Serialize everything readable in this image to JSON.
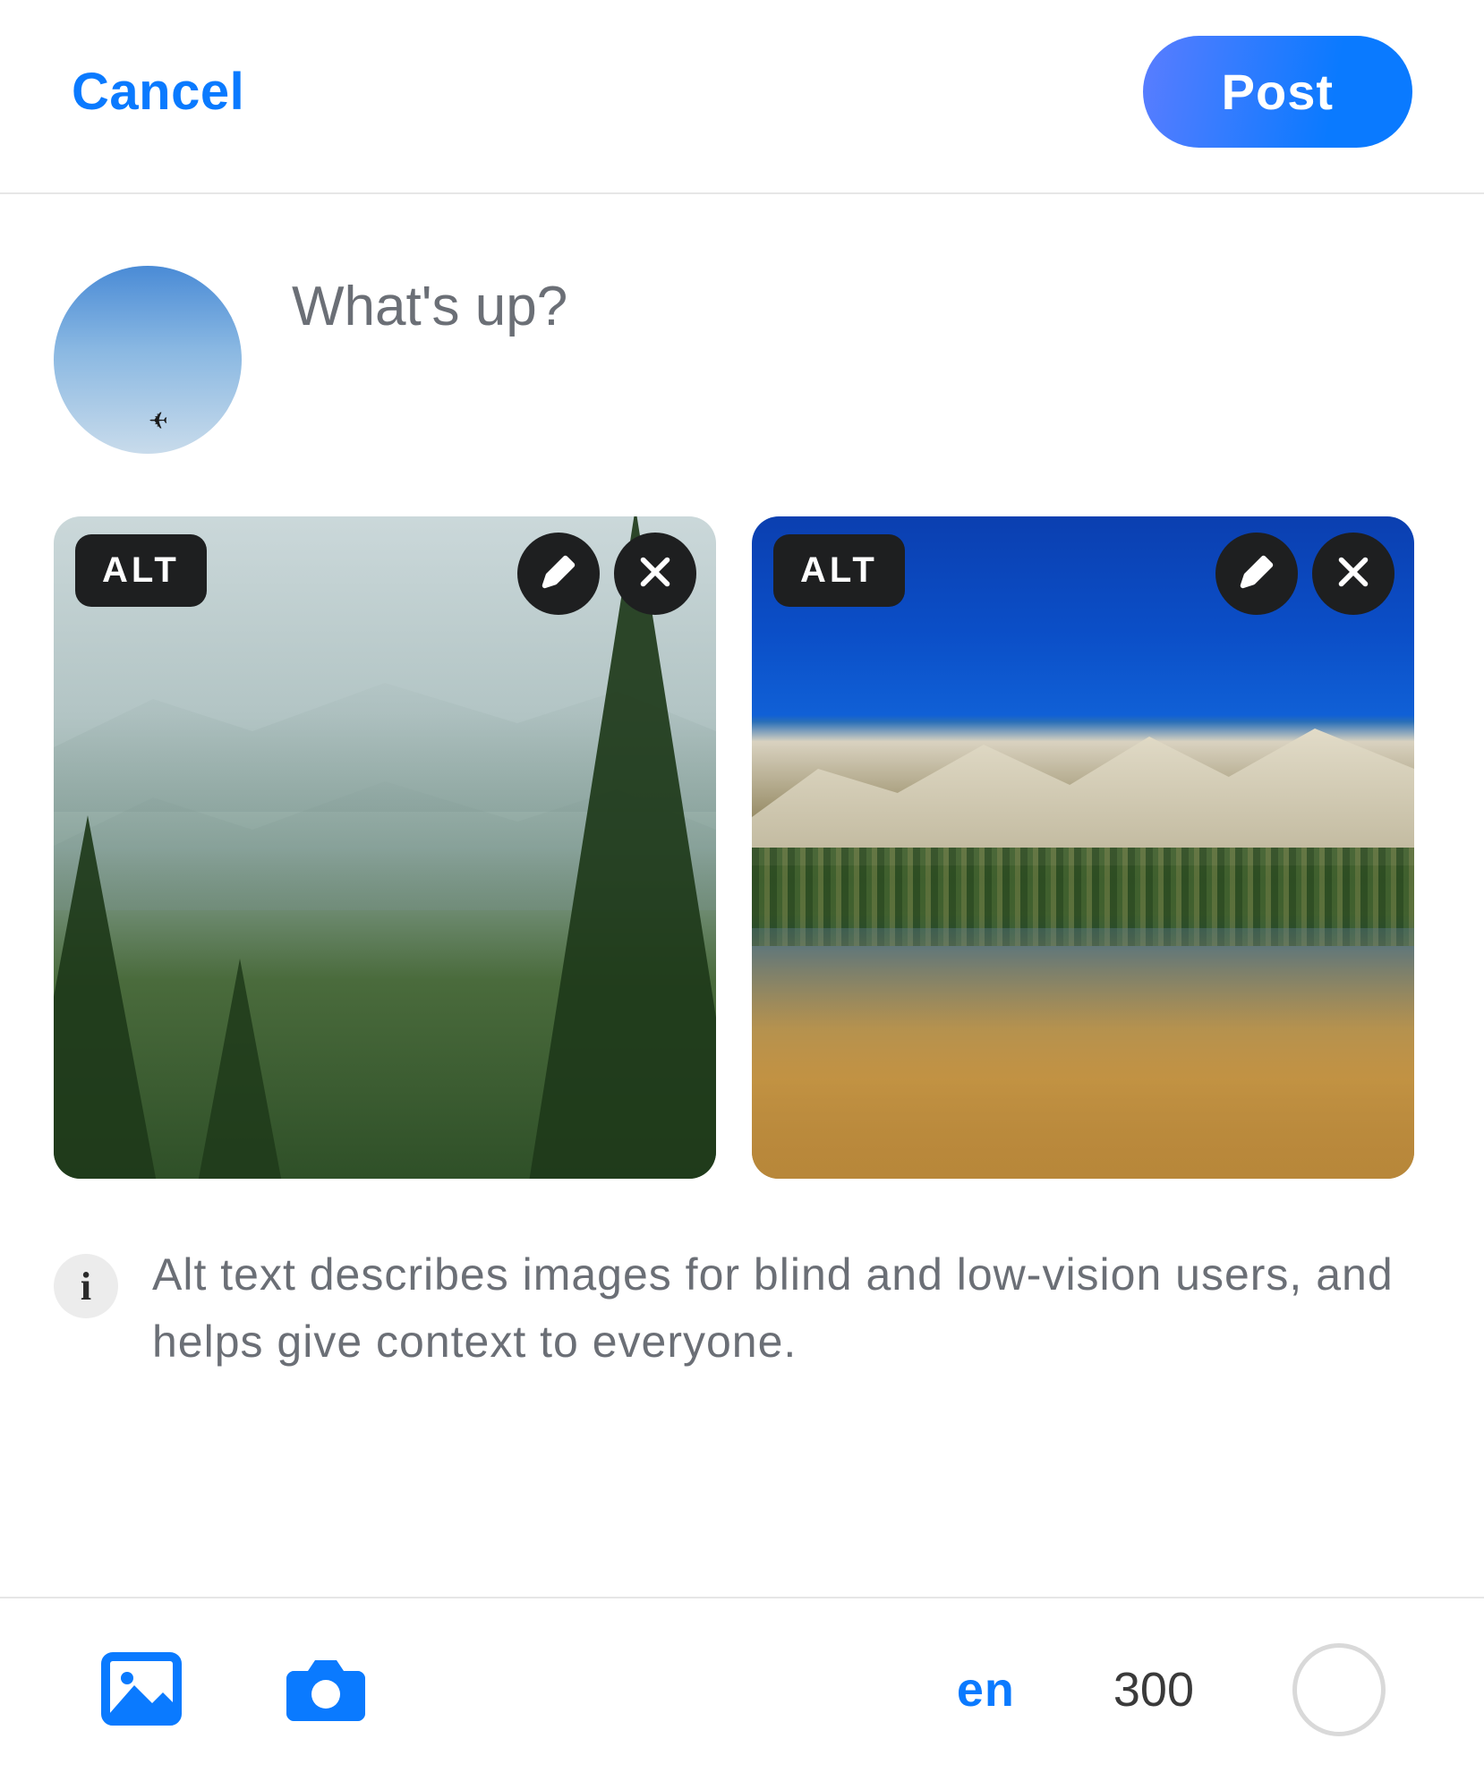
{
  "header": {
    "cancel_label": "Cancel",
    "post_label": "Post"
  },
  "composer": {
    "placeholder": "What's up?",
    "value": ""
  },
  "attachments": [
    {
      "alt_badge": "ALT"
    },
    {
      "alt_badge": "ALT"
    }
  ],
  "info_tip": {
    "icon_glyph": "i",
    "text": "Alt text describes images for blind and low-vision users, and helps give context to everyone."
  },
  "toolbar": {
    "language_label": "en",
    "char_remaining": "300"
  }
}
